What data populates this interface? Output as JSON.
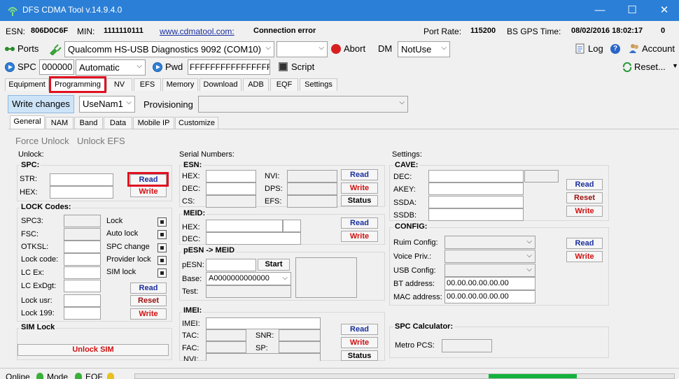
{
  "window": {
    "title": "DFS CDMA Tool v.14.9.4.0",
    "min": "—",
    "max": "☐",
    "close": "✕"
  },
  "infobar": {
    "esn_label": "ESN:",
    "esn": "806D0C6F",
    "min_label": "MIN:",
    "min": "1111110111",
    "link": "www.cdmatool.com:",
    "conn": "Connection error",
    "port_rate_label": "Port Rate:",
    "port_rate": "115200",
    "gps_label": "BS GPS Time:",
    "gps_time": "08/02/2016 18:02:17",
    "extra": "0"
  },
  "toolbar1": {
    "ports": "Ports",
    "device": "Qualcomm HS-USB Diagnostics 9092 (COM10)",
    "abort": "Abort",
    "dm": "DM",
    "dm_value": "NotUse",
    "log": "Log",
    "account": "Account"
  },
  "toolbar2": {
    "spc": "SPC",
    "spc_value": "000000",
    "mode": "Automatic",
    "pwd": "Pwd",
    "pwd_value": "FFFFFFFFFFFFFFFF",
    "script": "Script",
    "reset": "Reset..."
  },
  "maintabs": [
    "Equipment",
    "Programming",
    "NV",
    "EFS",
    "Memory",
    "Download",
    "ADB",
    "EQF",
    "Settings"
  ],
  "actionbar": {
    "write_changes": "Write changes",
    "profile": "UseNam1",
    "provisioning": "Provisioning"
  },
  "subtabs": [
    "General",
    "NAM",
    "Band",
    "Data",
    "Mobile IP",
    "Customize"
  ],
  "unlock": {
    "force": "Force Unlock",
    "efs": "Unlock EFS",
    "title": "Unlock:",
    "spc": "SPC:",
    "str": "STR:",
    "hex": "HEX:",
    "read": "Read",
    "write": "Write"
  },
  "lock": {
    "title": "LOCK Codes:",
    "fields": [
      "SPC3:",
      "FSC:",
      "OTKSL:",
      "Lock code:",
      "LC Ex:",
      "LC ExDgt:",
      "Lock usr:",
      "Lock 199:"
    ],
    "checks": [
      "Lock",
      "Auto lock",
      "SPC change",
      "Provider lock",
      "SIM lock"
    ],
    "read": "Read",
    "reset": "Reset",
    "write": "Write"
  },
  "simlock": {
    "title": "SIM Lock",
    "unlock": "Unlock SIM"
  },
  "serial": {
    "title": "Serial Numbers:",
    "esn": "ESN:",
    "hex": "HEX:",
    "dec": "DEC:",
    "cs": "CS:",
    "nvi": "NVI:",
    "dps": "DPS:",
    "efs": "EFS:",
    "read": "Read",
    "write": "Write",
    "status": "Status"
  },
  "meid": {
    "title": "MEID:",
    "hex": "HEX:",
    "dec": "DEC:",
    "read": "Read",
    "write": "Write"
  },
  "pesn": {
    "title": "pESN -> MEID",
    "pesn": "pESN:",
    "start": "Start",
    "base": "Base:",
    "base_value": "A0000000000000",
    "test": "Test:"
  },
  "imei": {
    "title": "IMEI:",
    "imei": "IMEI:",
    "tac": "TAC:",
    "snr": "SNR:",
    "fac": "FAC:",
    "sp": "SP:",
    "nvi": "NVI:",
    "read": "Read",
    "write": "Write",
    "status": "Status"
  },
  "settings": {
    "title": "Settings:",
    "cave": "CAVE:",
    "dec": "DEC:",
    "akey": "AKEY:",
    "ssda": "SSDA:",
    "ssdb": "SSDB:",
    "read": "Read",
    "reset": "Reset",
    "write": "Write"
  },
  "config": {
    "title": "CONFIG:",
    "ruim": "Ruim Config:",
    "voice": "Voice Priv.:",
    "usb": "USB Config:",
    "bt": "BT address:",
    "bt_value": "00.00.00.00.00.00",
    "mac": "MAC address:",
    "mac_value": "00.00.00.00.00.00",
    "read": "Read",
    "write": "Write"
  },
  "spccalc": {
    "title": "SPC Calculator:",
    "metro": "Metro PCS:"
  },
  "statusbar": {
    "online": "Online",
    "mode": "Mode",
    "eqf": "EQF",
    "progress": 0.2
  },
  "colors": {
    "titlebar": "#2b7fd6",
    "highlight": "#e01020",
    "read": "#1a2f9c",
    "write": "#d01010",
    "progress": "#12b23c"
  }
}
